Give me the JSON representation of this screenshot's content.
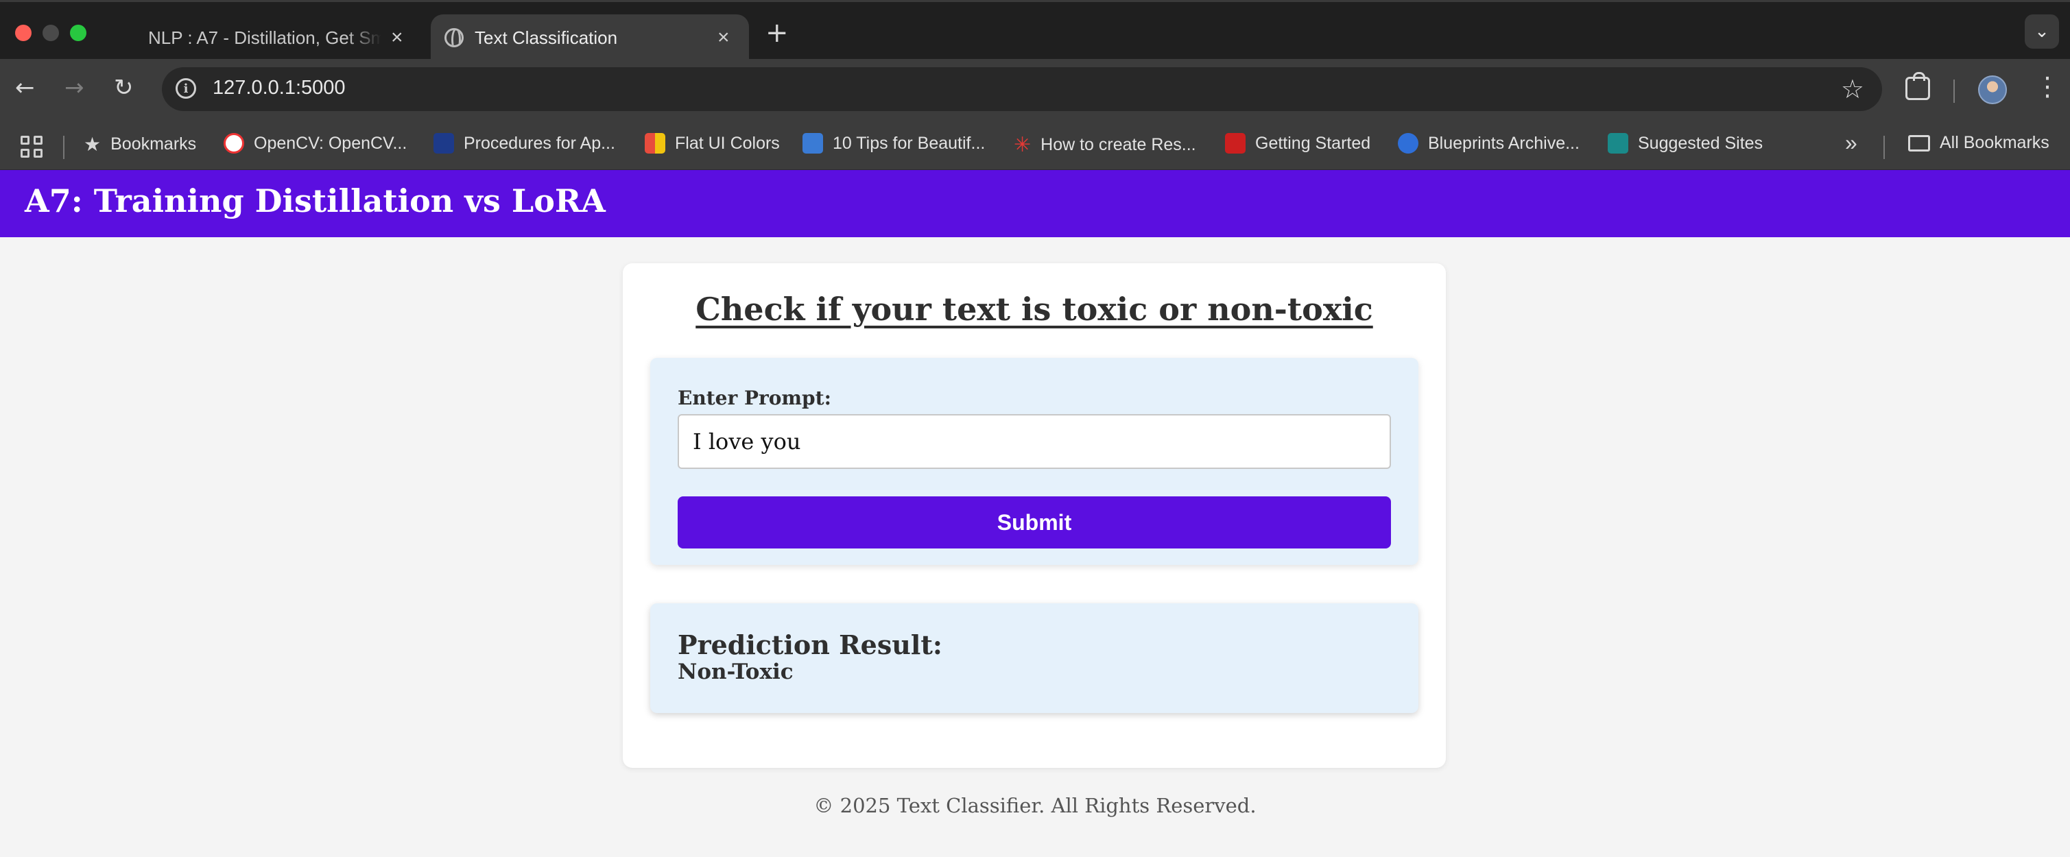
{
  "browser": {
    "tabs": [
      {
        "title": "NLP : A7 - Distillation, Get Sm",
        "active": false
      },
      {
        "title": "Text Classification",
        "active": true
      }
    ],
    "new_tab_label": "+",
    "tab_menu_icon": "chevron-down-icon",
    "url": "127.0.0.1:5000",
    "bookmarks": [
      {
        "label": "Bookmarks",
        "icon": "star-icon"
      },
      {
        "label": "OpenCV: OpenCV...",
        "icon": "opencv-icon",
        "color": "#ffffff"
      },
      {
        "label": "Procedures for Ap...",
        "icon": "adb-icon",
        "color": "#1d3a8a"
      },
      {
        "label": "Flat UI Colors",
        "icon": "flatui-icon",
        "color": "#e84c3d"
      },
      {
        "label": "10 Tips for Beautif...",
        "icon": "db-icon",
        "color": "#3a7bd5"
      },
      {
        "label": "How to create Res...",
        "icon": "spark-icon",
        "color": "#e53935"
      },
      {
        "label": "Getting Started",
        "icon": "redhat-icon",
        "color": "#cc1f1f"
      },
      {
        "label": "Blueprints Archive...",
        "icon": "drop-icon",
        "color": "#2f6fd8"
      },
      {
        "label": "Suggested Sites",
        "icon": "bing-icon",
        "color": "#1a8a8a"
      }
    ],
    "overflow_label": "»",
    "all_bookmarks": "All Bookmarks"
  },
  "header": {
    "title": "A7: Training Distillation vs LoRA",
    "color": "#5b0fe0"
  },
  "main": {
    "heading": "Check if your text is toxic or non-toxic",
    "form": {
      "label": "Enter Prompt:",
      "input_value": "I love you",
      "submit_label": "Submit"
    },
    "result": {
      "label": "Prediction Result:",
      "value": "Non-Toxic"
    }
  },
  "footer": {
    "text": "© 2025 Text Classifier. All Rights Reserved."
  }
}
